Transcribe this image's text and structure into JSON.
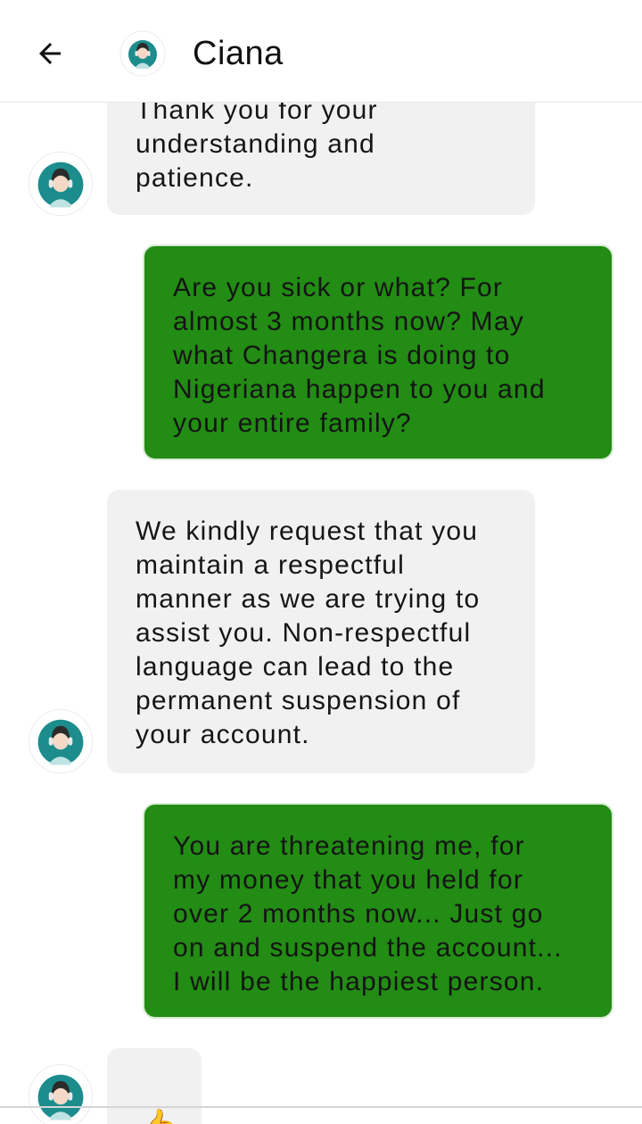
{
  "header": {
    "title": "Ciana",
    "back_icon": "arrow-left-icon",
    "avatar_icon": "agent-headset-avatar-icon"
  },
  "messages": [
    {
      "sender": "agent",
      "text": "Thank you for your\nunderstanding and\npatience."
    },
    {
      "sender": "user",
      "text": "Are you sick or what? For\nalmost 3 months now? May\nwhat Changera is doing to\nNigeriana happen to you and\nyour entire family?"
    },
    {
      "sender": "agent",
      "text": "We kindly request that you\nmaintain a respectful\nmanner as we are trying to\nassist you. Non-respectful\nlanguage can lead to the\npermanent suspension of\nyour account."
    },
    {
      "sender": "user",
      "text": "You are threatening me, for\nmy money that you held for\nover 2 months now... Just go\non and suspend the account...\nI will be the happiest person."
    },
    {
      "sender": "agent",
      "text": "👍"
    }
  ],
  "colors": {
    "user_bubble": "#228c14",
    "agent_bubble": "#f1f1f1",
    "avatar_teal": "#1c8c8c"
  }
}
